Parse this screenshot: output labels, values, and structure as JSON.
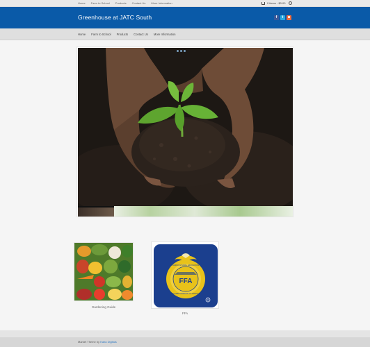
{
  "topbar": {
    "links": [
      "Home",
      "Farm to School",
      "Products",
      "Contact Us",
      "More Information"
    ],
    "cart_text": "0 items - $0.00"
  },
  "header": {
    "site_title": "Greenhouse at JATC South",
    "social": [
      {
        "name": "facebook-icon",
        "glyph": "f"
      },
      {
        "name": "twitter-icon",
        "glyph": "t"
      },
      {
        "name": "instagram-icon",
        "glyph": "◙"
      }
    ]
  },
  "main_nav": {
    "items": [
      "Home",
      "Farm to School",
      "Products",
      "Contact Us",
      "More Information"
    ]
  },
  "slider": {
    "slide_count": 3,
    "active_index": 0
  },
  "cards": [
    {
      "label": "Gardening Guide"
    },
    {
      "label": "FFA"
    }
  ],
  "ffa_logo": {
    "top_text": "AGRICULTURAL EDUCATION",
    "center_text": "FFA",
    "bottom_text": "FUTURE FARMERS OF AMERICA"
  },
  "footer": {
    "credit_prefix": "Market Theme by",
    "credit_link": "Kaira Digitals"
  },
  "colors": {
    "header_blue": "#0a5aa8",
    "link_blue": "#2a78c4",
    "ffa_blue": "#1b3f8e",
    "ffa_gold": "#e8c21a"
  }
}
